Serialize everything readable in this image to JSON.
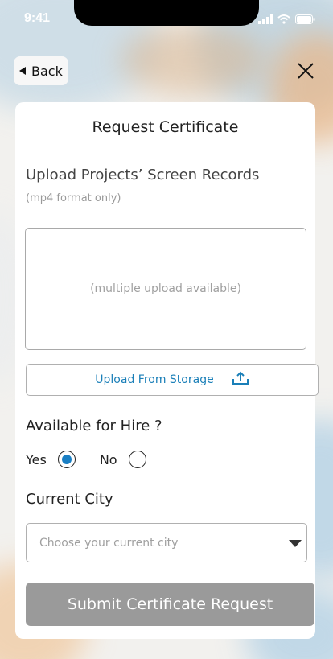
{
  "status": {
    "time": "9:41"
  },
  "nav": {
    "back_label": "Back"
  },
  "card": {
    "title": "Request Certificate",
    "upload_label": "Upload Projects’ Screen Records",
    "upload_hint": "(mp4 format only)",
    "dropzone_text": "(multiple upload available)",
    "storage_button_label": "Upload From Storage",
    "hire_label": "Available for Hire ?",
    "hire_options": [
      {
        "label": "Yes",
        "selected": true
      },
      {
        "label": "No",
        "selected": false
      }
    ],
    "city_label": "Current City",
    "city_placeholder": "Choose your current city",
    "submit_label": "Submit Certificate Request"
  },
  "colors": {
    "accent": "#1a7fc4",
    "link": "#1a7fb8",
    "submit_bg": "#9a9a9a"
  },
  "icons": [
    "back-arrow-icon",
    "close-icon",
    "upload-icon",
    "chevron-down-icon",
    "signal-icon",
    "wifi-icon",
    "battery-icon"
  ]
}
